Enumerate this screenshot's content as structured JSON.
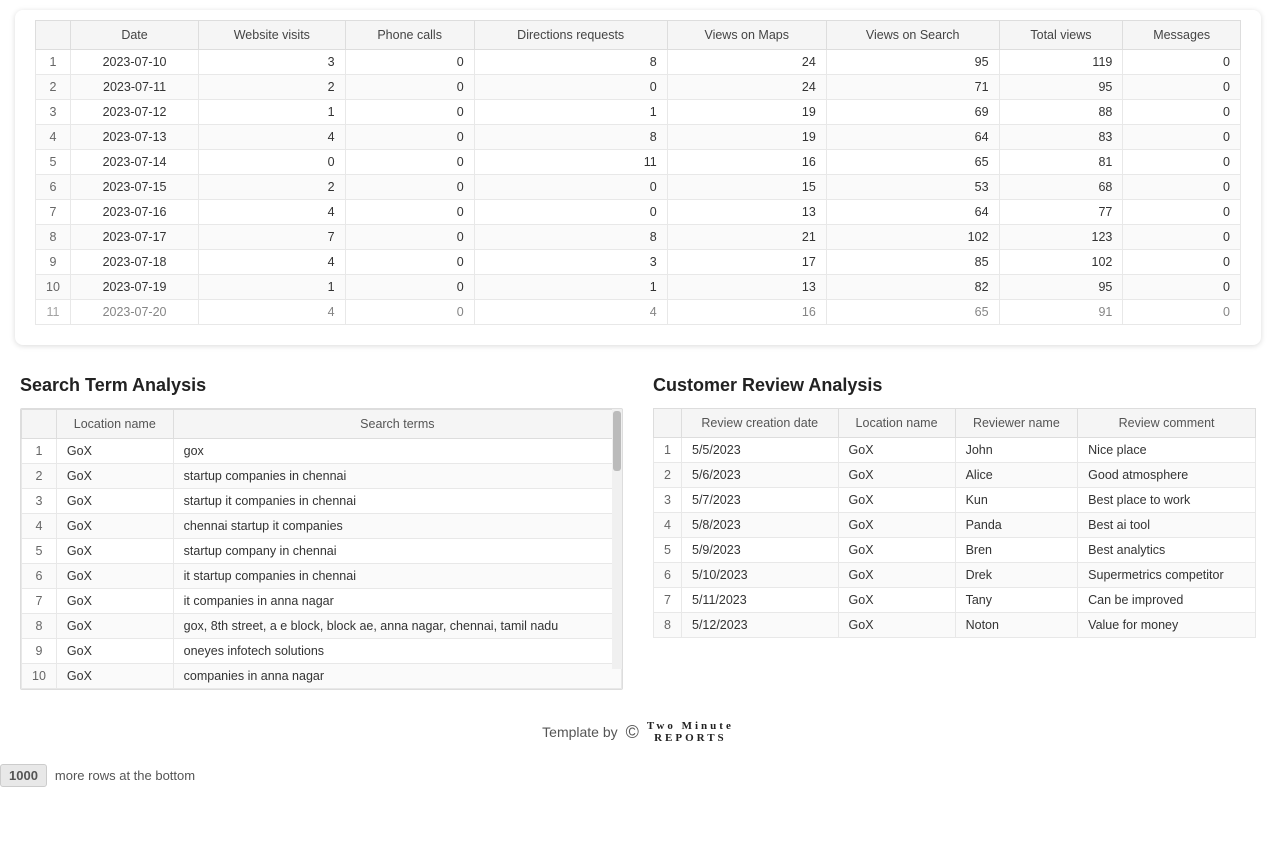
{
  "topTable": {
    "columns": [
      "Date",
      "Website visits",
      "Phone calls",
      "Directions requests",
      "Views on Maps",
      "Views on Search",
      "Total views",
      "Messages"
    ],
    "rows": [
      [
        1,
        "2023-07-10",
        3,
        0,
        8,
        24,
        95,
        119,
        0
      ],
      [
        2,
        "2023-07-11",
        2,
        0,
        0,
        24,
        71,
        95,
        0
      ],
      [
        3,
        "2023-07-12",
        1,
        0,
        1,
        19,
        69,
        88,
        0
      ],
      [
        4,
        "2023-07-13",
        4,
        0,
        8,
        19,
        64,
        83,
        0
      ],
      [
        5,
        "2023-07-14",
        0,
        0,
        11,
        16,
        65,
        81,
        0
      ],
      [
        6,
        "2023-07-15",
        2,
        0,
        0,
        15,
        53,
        68,
        0
      ],
      [
        7,
        "2023-07-16",
        4,
        0,
        0,
        13,
        64,
        77,
        0
      ],
      [
        8,
        "2023-07-17",
        7,
        0,
        8,
        21,
        102,
        123,
        0
      ],
      [
        9,
        "2023-07-18",
        4,
        0,
        3,
        17,
        85,
        102,
        0
      ],
      [
        10,
        "2023-07-19",
        1,
        0,
        1,
        13,
        82,
        95,
        0
      ],
      [
        11,
        "2023-07-20",
        4,
        0,
        4,
        16,
        65,
        91,
        0
      ]
    ]
  },
  "searchAnalysis": {
    "title": "Search Term Analysis",
    "columns": [
      "Location name",
      "Search terms"
    ],
    "rows": [
      [
        1,
        "GoX",
        "gox"
      ],
      [
        2,
        "GoX",
        "startup companies in chennai"
      ],
      [
        3,
        "GoX",
        "startup it companies in chennai"
      ],
      [
        4,
        "GoX",
        "chennai startup it companies"
      ],
      [
        5,
        "GoX",
        "startup company in chennai"
      ],
      [
        6,
        "GoX",
        "it startup companies in chennai"
      ],
      [
        7,
        "GoX",
        "it companies in anna nagar"
      ],
      [
        8,
        "GoX",
        "gox, 8th street, a e block, block ae, anna nagar, chennai, tamil nadu"
      ],
      [
        9,
        "GoX",
        "oneyes infotech solutions"
      ],
      [
        10,
        "GoX",
        "companies in anna nagar"
      ]
    ]
  },
  "reviewAnalysis": {
    "title": "Customer Review Analysis",
    "columns": [
      "Review creation date",
      "Location name",
      "Reviewer name",
      "Review comment"
    ],
    "rows": [
      [
        1,
        "5/5/2023",
        "GoX",
        "John",
        "Nice place"
      ],
      [
        2,
        "5/6/2023",
        "GoX",
        "Alice",
        "Good atmosphere"
      ],
      [
        3,
        "5/7/2023",
        "GoX",
        "Kun",
        "Best place to work"
      ],
      [
        4,
        "5/8/2023",
        "GoX",
        "Panda",
        "Best ai tool"
      ],
      [
        5,
        "5/9/2023",
        "GoX",
        "Bren",
        "Best analytics"
      ],
      [
        6,
        "5/10/2023",
        "GoX",
        "Drek",
        "Supermetrics competitor"
      ],
      [
        7,
        "5/11/2023",
        "GoX",
        "Tany",
        "Can be improved"
      ],
      [
        8,
        "5/12/2023",
        "GoX",
        "Noton",
        "Value for money"
      ]
    ]
  },
  "footer": {
    "templateBy": "Template by",
    "copyrightSymbol": "©",
    "brandLine1": "Two Minute",
    "brandLine2": "REPORTS"
  },
  "bottomBar": {
    "rowCount": "1000",
    "moreRowsText": "more rows at the bottom"
  }
}
